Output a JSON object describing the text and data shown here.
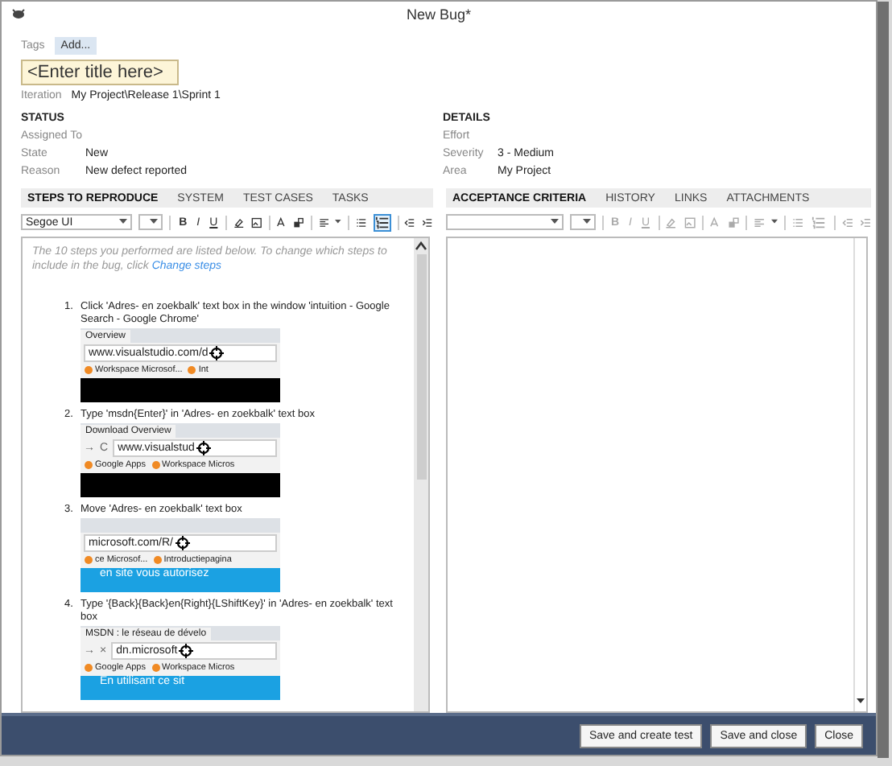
{
  "window": {
    "title": "New Bug*"
  },
  "tags": {
    "label": "Tags",
    "button": "Add..."
  },
  "title_field": {
    "placeholder": "<Enter title here>"
  },
  "iteration": {
    "label": "Iteration",
    "value": "My Project\\Release 1\\Sprint 1"
  },
  "status": {
    "heading": "STATUS",
    "fields": [
      {
        "label": "Assigned To"
      },
      {
        "label": "State",
        "value": "New"
      },
      {
        "label": "Reason",
        "value": "New defect reported"
      }
    ]
  },
  "details": {
    "heading": "DETAILS",
    "fields": [
      {
        "label": "Effort"
      },
      {
        "label": "Severity",
        "value": "3 - Medium"
      },
      {
        "label": "Area",
        "value": "My Project"
      }
    ]
  },
  "left_panel": {
    "tabs": [
      {
        "label": "STEPS TO REPRODUCE",
        "selected": true
      },
      {
        "label": "SYSTEM",
        "selected": false
      },
      {
        "label": "TEST CASES",
        "selected": false
      },
      {
        "label": "TASKS",
        "selected": false
      }
    ],
    "toolbar": {
      "font": "Segoe UI",
      "format_buttons": [
        "B",
        "I",
        "U"
      ],
      "disabled": false,
      "numbered_list_on": true
    },
    "intro": "The 10 steps you performed are listed below. To change which steps to include in the bug, click ",
    "intro_link": "Change steps",
    "steps": [
      {
        "number": "1.",
        "text": "Click 'Adres- en zoekbalk' text box in the window 'intuition - Google Search - Google Chrome'",
        "thumbnail": {
          "tab": "Overview",
          "url": "www.visualstudio.com/d",
          "bookmarks": [
            "Workspace Microsof...",
            "Int"
          ],
          "banner": {
            "color": "#000000"
          }
        }
      },
      {
        "number": "2.",
        "text": "Type 'msdn{Enter}' in 'Adres- en zoekbalk' text box",
        "thumbnail": {
          "tab": "Download Overview",
          "nav": [
            "→",
            "C"
          ],
          "url": "www.visualstud",
          "bookmarks": [
            "Google Apps",
            "Workspace Micros"
          ],
          "banner": {
            "color": "#000000"
          }
        }
      },
      {
        "number": "3.",
        "text": "Move 'Adres- en zoekbalk' text box",
        "thumbnail": {
          "url": "microsoft.com/R/",
          "bookmarks": [
            "ce Microsof...",
            "Introductiepagina"
          ],
          "banner": {
            "color": "#1ba1e2",
            "text": "en site vous autorisez"
          }
        }
      },
      {
        "number": "4.",
        "text": "Type '{Back}{Back}en{Right}{LShiftKey}' in 'Adres- en zoekbalk' text box",
        "thumbnail": {
          "tab": "MSDN : le réseau de dévelo",
          "nav": [
            "→",
            "×"
          ],
          "url": "dn.microsoft",
          "bookmarks": [
            "Google Apps",
            "Workspace Micros"
          ],
          "banner": {
            "color": "#1ba1e2",
            "text": "En utilisant ce sit"
          }
        }
      }
    ]
  },
  "right_panel": {
    "tabs": [
      {
        "label": "ACCEPTANCE CRITERIA",
        "selected": true
      },
      {
        "label": "HISTORY",
        "selected": false
      },
      {
        "label": "LINKS",
        "selected": false
      },
      {
        "label": "ATTACHMENTS",
        "selected": false
      }
    ],
    "toolbar": {
      "format_buttons": [
        "B",
        "I",
        "U"
      ],
      "disabled": true,
      "numbered_list_on": false
    }
  },
  "buttons": [
    "Save and create test",
    "Save and close",
    "Close"
  ]
}
